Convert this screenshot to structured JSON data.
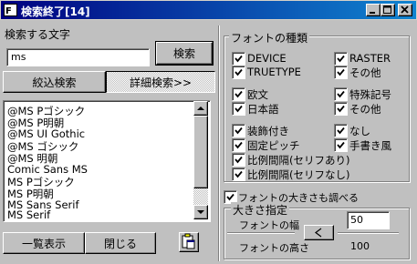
{
  "window": {
    "title": "検索終了[14]",
    "controls": {
      "minimize": "_",
      "maximize": "□",
      "close": "✕"
    }
  },
  "search": {
    "label": "検索する文字",
    "value": "ms",
    "button": "検索",
    "tabs": [
      {
        "label": "絞込検索"
      },
      {
        "label": "詳細検索>>"
      }
    ]
  },
  "font_list": {
    "items": [
      "@MS Pゴシック",
      "@MS P明朝",
      "@MS UI Gothic",
      "@MS ゴシック",
      "@MS 明朝",
      "Comic Sans MS",
      "MS Pゴシック",
      "MS P明朝",
      "MS Sans Serif",
      "MS Serif"
    ]
  },
  "bottom_buttons": {
    "list_view": "一覧表示",
    "close": "閉じる",
    "copy_icon": "clipboard-icon"
  },
  "font_type": {
    "legend": "フォントの種類",
    "checkboxes": [
      {
        "label": "DEVICE",
        "checked": true
      },
      {
        "label": "RASTER",
        "checked": true
      },
      {
        "label": "TRUETYPE",
        "checked": true
      },
      {
        "label": "その他",
        "checked": true
      },
      {
        "label": "欧文",
        "checked": true
      },
      {
        "label": "特殊記号",
        "checked": true
      },
      {
        "label": "日本語",
        "checked": true
      },
      {
        "label": "その他",
        "checked": true
      },
      {
        "label": "装飾付き",
        "checked": true
      },
      {
        "label": "なし",
        "checked": true
      },
      {
        "label": "固定ピッチ",
        "checked": true
      },
      {
        "label": "手書き風",
        "checked": true
      },
      {
        "label": "比例間隔(セリフあり)",
        "checked": true
      },
      {
        "label": "比例間隔(セリフなし)",
        "checked": true
      }
    ]
  },
  "size": {
    "check_label": "フォントの大きさも調べる",
    "check_checked": true,
    "legend": "大きさ指定",
    "width_label": "フォントの幅",
    "height_label": "フォントの高さ",
    "width_value": "50",
    "height_value": "100",
    "arrow_button": "<"
  }
}
